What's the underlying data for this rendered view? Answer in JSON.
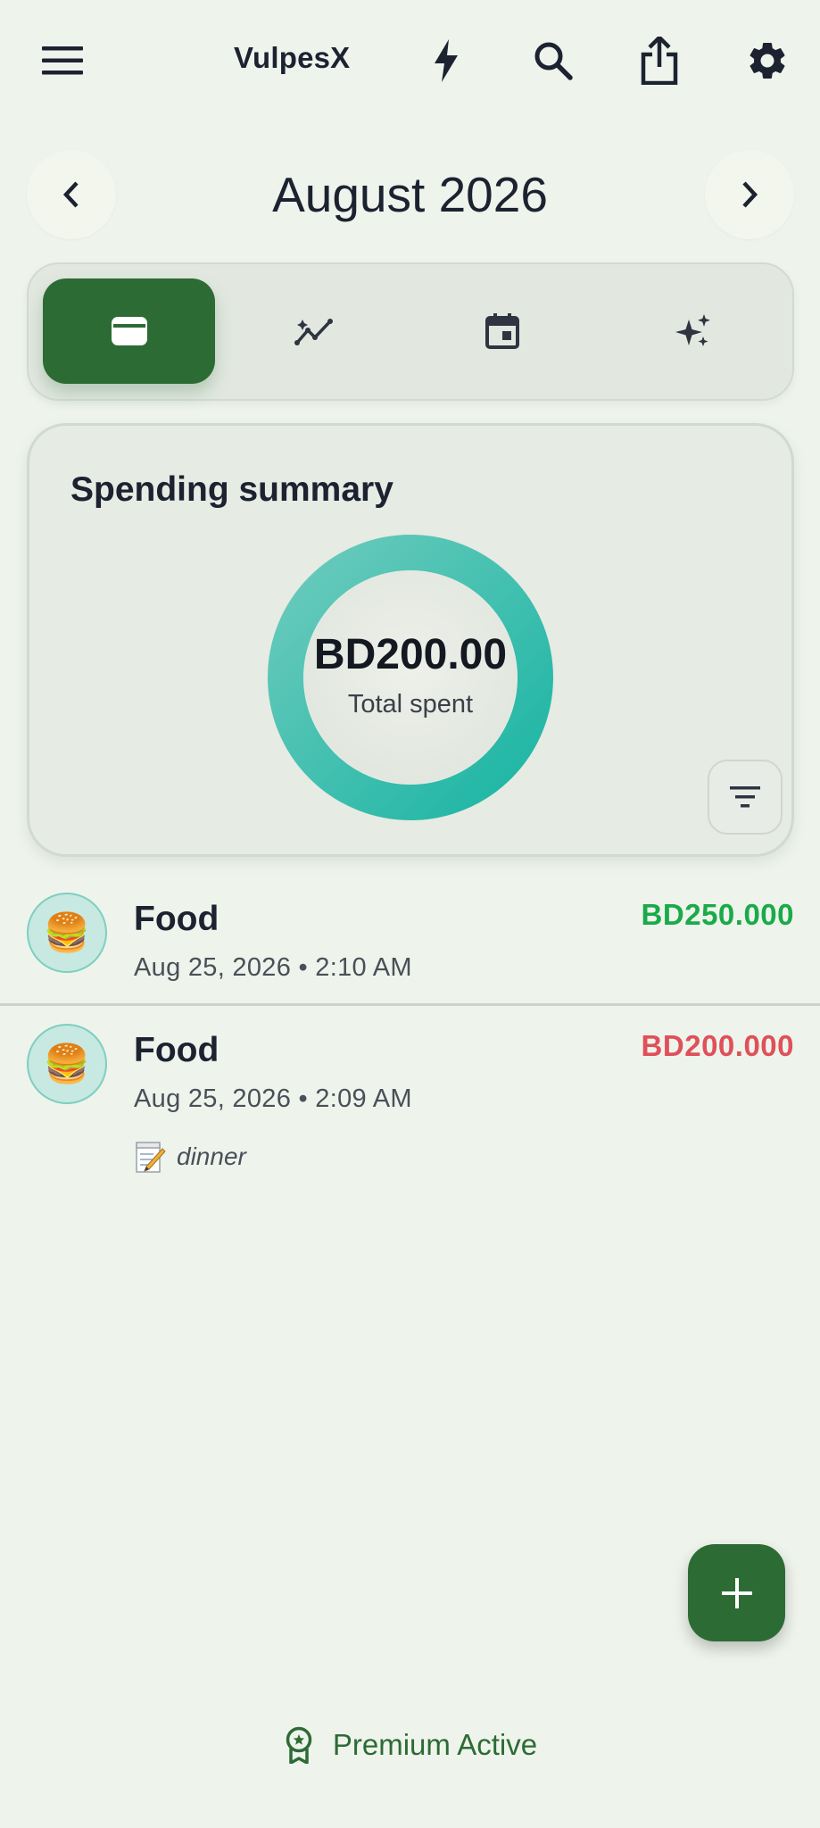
{
  "app": {
    "title": "VulpesX"
  },
  "topbar": {
    "icons": [
      "menu-icon",
      "lightning-icon",
      "search-icon",
      "share-icon",
      "settings-icon"
    ]
  },
  "month": {
    "label": "August 2026",
    "prev_icon": "chevron-left-icon",
    "next_icon": "chevron-right-icon"
  },
  "tabs": [
    {
      "icon": "wallet-icon",
      "active": true
    },
    {
      "icon": "trend-icon",
      "active": false
    },
    {
      "icon": "calendar-icon",
      "active": false
    },
    {
      "icon": "sparkle-icon",
      "active": false
    }
  ],
  "summary": {
    "title": "Spending summary",
    "total": "BD200.00",
    "total_label": "Total spent",
    "filter_icon": "filter-icon"
  },
  "transactions": [
    {
      "emoji": "🍔",
      "category": "Food",
      "date": "Aug 25, 2026 • 2:10 AM",
      "amount": "BD250.000",
      "amount_color": "#1aaa4a",
      "note": ""
    },
    {
      "emoji": "🍔",
      "category": "Food",
      "date": "Aug 25, 2026 • 2:09 AM",
      "amount": "BD200.000",
      "amount_color": "#e0505a",
      "note": "dinner",
      "note_icon": "memo-icon"
    }
  ],
  "fab": {
    "icon": "plus-icon"
  },
  "premium": {
    "label": "Premium Active",
    "icon": "award-icon"
  },
  "colors": {
    "primary": "#2d6b35",
    "background": "#eef4ec",
    "donut_start": "#5ec7b6",
    "donut_end": "#1eb7a6",
    "income": "#1aaa4a",
    "expense": "#e0505a"
  }
}
